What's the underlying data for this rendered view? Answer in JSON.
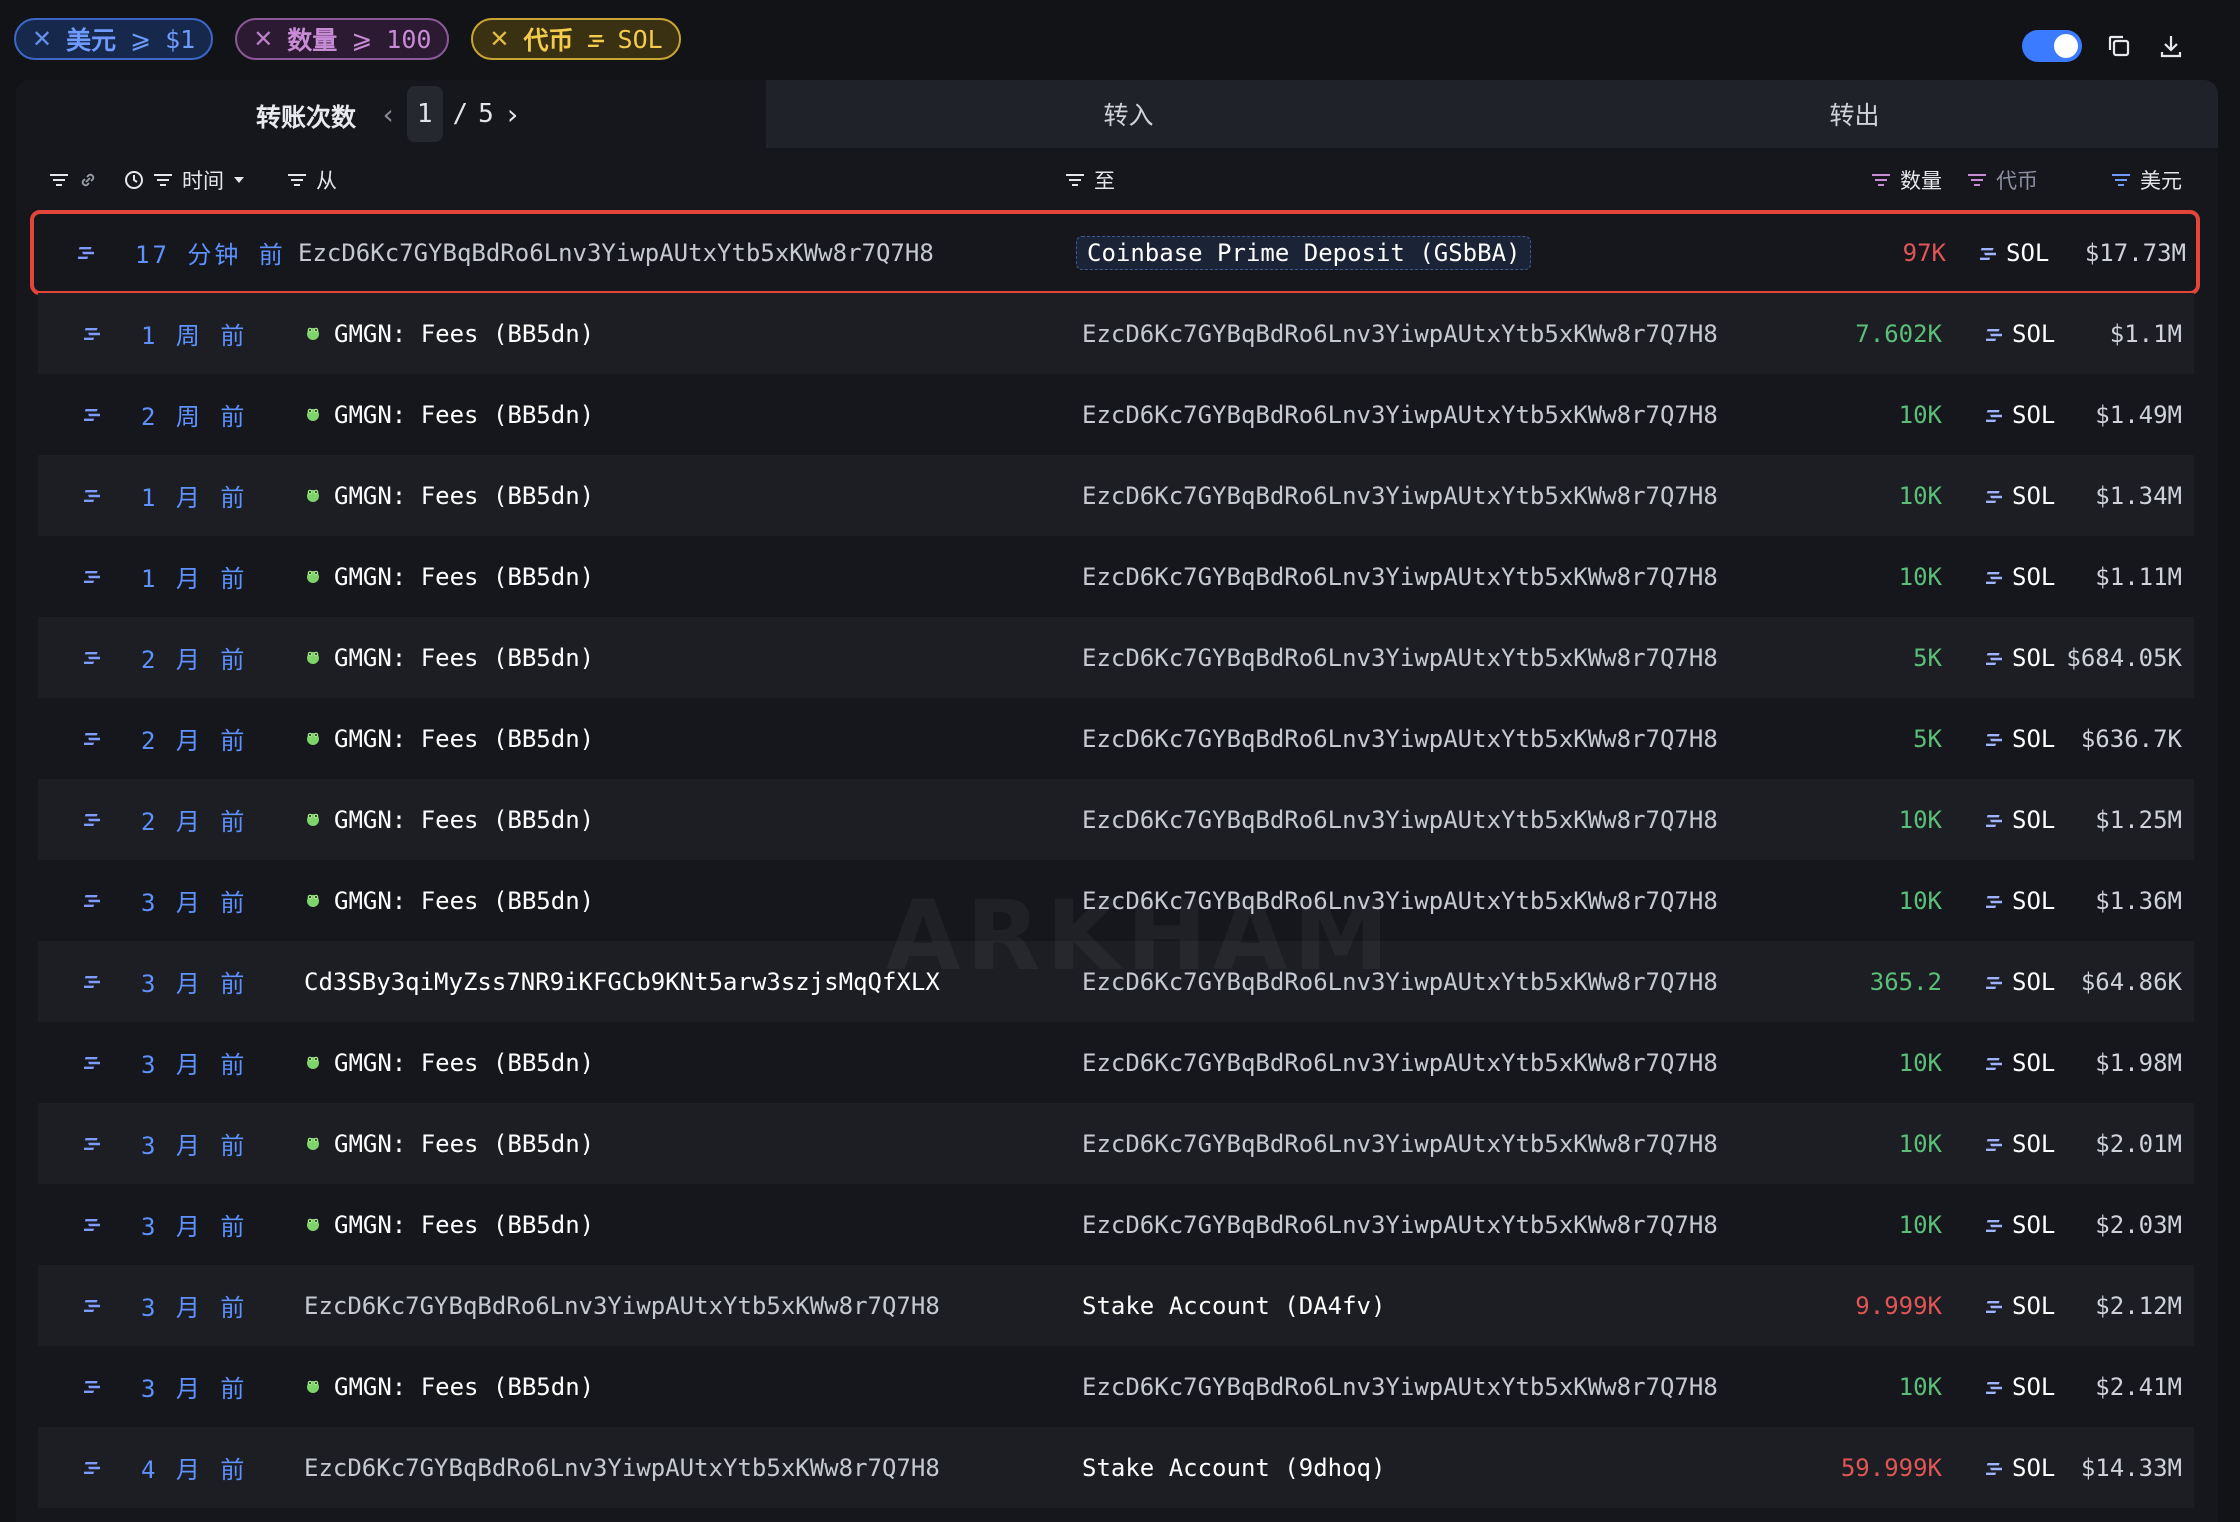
{
  "filters": [
    {
      "label": "美元",
      "operator": "⩾",
      "value": "$1",
      "color": "blue"
    },
    {
      "label": "数量",
      "operator": "⩾",
      "value": "100",
      "color": "purple"
    },
    {
      "label": "代币",
      "operator": "",
      "value": "SOL",
      "color": "yellow"
    }
  ],
  "tabs": {
    "title": "转账次数",
    "page_current": "1",
    "page_sep": "/",
    "page_total": "5",
    "inflow": "转入",
    "outflow": "转出"
  },
  "header": {
    "time": "时间",
    "from": "从",
    "to": "至",
    "amount": "数量",
    "token": "代币",
    "usd": "美元"
  },
  "watermark": "ARKHAM",
  "rows": [
    {
      "time": "17 分钟 前",
      "from": "EzcD6Kc7GYBqBdRo6Lnv3YiwpAUtxYtb5xKWw8r7Q7H8",
      "from_named": false,
      "to": "Coinbase Prime Deposit (GSbBA)",
      "to_named": true,
      "amount": "97K",
      "amount_color": "red",
      "token": "SOL",
      "usd": "$17.73M",
      "highlight": true
    },
    {
      "time": "1 周 前",
      "from": "GMGN: Fees (BB5dn)",
      "from_named": true,
      "to": "EzcD6Kc7GYBqBdRo6Lnv3YiwpAUtxYtb5xKWw8r7Q7H8",
      "to_named": false,
      "amount": "7.602K",
      "amount_color": "green",
      "token": "SOL",
      "usd": "$1.1M"
    },
    {
      "time": "2 周 前",
      "from": "GMGN: Fees (BB5dn)",
      "from_named": true,
      "to": "EzcD6Kc7GYBqBdRo6Lnv3YiwpAUtxYtb5xKWw8r7Q7H8",
      "to_named": false,
      "amount": "10K",
      "amount_color": "green",
      "token": "SOL",
      "usd": "$1.49M"
    },
    {
      "time": "1 月 前",
      "from": "GMGN: Fees (BB5dn)",
      "from_named": true,
      "to": "EzcD6Kc7GYBqBdRo6Lnv3YiwpAUtxYtb5xKWw8r7Q7H8",
      "to_named": false,
      "amount": "10K",
      "amount_color": "green",
      "token": "SOL",
      "usd": "$1.34M"
    },
    {
      "time": "1 月 前",
      "from": "GMGN: Fees (BB5dn)",
      "from_named": true,
      "to": "EzcD6Kc7GYBqBdRo6Lnv3YiwpAUtxYtb5xKWw8r7Q7H8",
      "to_named": false,
      "amount": "10K",
      "amount_color": "green",
      "token": "SOL",
      "usd": "$1.11M"
    },
    {
      "time": "2 月 前",
      "from": "GMGN: Fees (BB5dn)",
      "from_named": true,
      "to": "EzcD6Kc7GYBqBdRo6Lnv3YiwpAUtxYtb5xKWw8r7Q7H8",
      "to_named": false,
      "amount": "5K",
      "amount_color": "green",
      "token": "SOL",
      "usd": "$684.05K"
    },
    {
      "time": "2 月 前",
      "from": "GMGN: Fees (BB5dn)",
      "from_named": true,
      "to": "EzcD6Kc7GYBqBdRo6Lnv3YiwpAUtxYtb5xKWw8r7Q7H8",
      "to_named": false,
      "amount": "5K",
      "amount_color": "green",
      "token": "SOL",
      "usd": "$636.7K"
    },
    {
      "time": "2 月 前",
      "from": "GMGN: Fees (BB5dn)",
      "from_named": true,
      "to": "EzcD6Kc7GYBqBdRo6Lnv3YiwpAUtxYtb5xKWw8r7Q7H8",
      "to_named": false,
      "amount": "10K",
      "amount_color": "green",
      "token": "SOL",
      "usd": "$1.25M"
    },
    {
      "time": "3 月 前",
      "from": "GMGN: Fees (BB5dn)",
      "from_named": true,
      "to": "EzcD6Kc7GYBqBdRo6Lnv3YiwpAUtxYtb5xKWw8r7Q7H8",
      "to_named": false,
      "amount": "10K",
      "amount_color": "green",
      "token": "SOL",
      "usd": "$1.36M"
    },
    {
      "time": "3 月 前",
      "from": "Cd3SBy3qiMyZss7NR9iKFGCb9KNt5arw3szjsMqQfXLX",
      "from_named": false,
      "to": "EzcD6Kc7GYBqBdRo6Lnv3YiwpAUtxYtb5xKWw8r7Q7H8",
      "to_named": false,
      "amount": "365.2",
      "amount_color": "green",
      "token": "SOL",
      "usd": "$64.86K",
      "from_plain": true
    },
    {
      "time": "3 月 前",
      "from": "GMGN: Fees (BB5dn)",
      "from_named": true,
      "to": "EzcD6Kc7GYBqBdRo6Lnv3YiwpAUtxYtb5xKWw8r7Q7H8",
      "to_named": false,
      "amount": "10K",
      "amount_color": "green",
      "token": "SOL",
      "usd": "$1.98M"
    },
    {
      "time": "3 月 前",
      "from": "GMGN: Fees (BB5dn)",
      "from_named": true,
      "to": "EzcD6Kc7GYBqBdRo6Lnv3YiwpAUtxYtb5xKWw8r7Q7H8",
      "to_named": false,
      "amount": "10K",
      "amount_color": "green",
      "token": "SOL",
      "usd": "$2.01M"
    },
    {
      "time": "3 月 前",
      "from": "GMGN: Fees (BB5dn)",
      "from_named": true,
      "to": "EzcD6Kc7GYBqBdRo6Lnv3YiwpAUtxYtb5xKWw8r7Q7H8",
      "to_named": false,
      "amount": "10K",
      "amount_color": "green",
      "token": "SOL",
      "usd": "$2.03M"
    },
    {
      "time": "3 月 前",
      "from": "EzcD6Kc7GYBqBdRo6Lnv3YiwpAUtxYtb5xKWw8r7Q7H8",
      "from_named": false,
      "to": "Stake Account (DA4fv)",
      "to_named": true,
      "amount": "9.999K",
      "amount_color": "red",
      "token": "SOL",
      "usd": "$2.12M"
    },
    {
      "time": "3 月 前",
      "from": "GMGN: Fees (BB5dn)",
      "from_named": true,
      "to": "EzcD6Kc7GYBqBdRo6Lnv3YiwpAUtxYtb5xKWw8r7Q7H8",
      "to_named": false,
      "amount": "10K",
      "amount_color": "green",
      "token": "SOL",
      "usd": "$2.41M"
    },
    {
      "time": "4 月 前",
      "from": "EzcD6Kc7GYBqBdRo6Lnv3YiwpAUtxYtb5xKWw8r7Q7H8",
      "from_named": false,
      "to": "Stake Account (9dhoq)",
      "to_named": true,
      "amount": "59.999K",
      "amount_color": "red",
      "token": "SOL",
      "usd": "$14.33M"
    }
  ]
}
